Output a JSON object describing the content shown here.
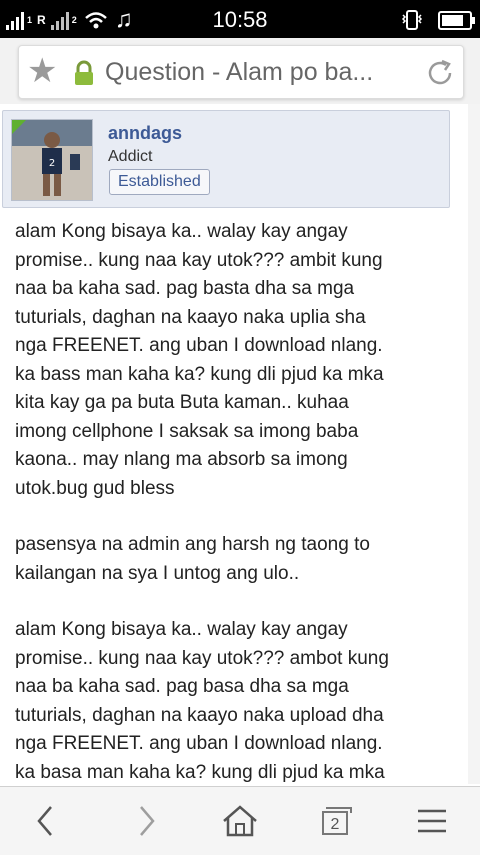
{
  "status_bar": {
    "carrier_label": "R",
    "time": "10:58"
  },
  "browser": {
    "page_title": "Question - Alam po ba...",
    "icons": [
      "star-icon",
      "lock-icon",
      "reload-icon",
      "back-icon",
      "forward-icon",
      "home-icon",
      "tabs-icon",
      "menu-icon"
    ],
    "tab_count": "2"
  },
  "post": {
    "author": {
      "username": "anndags",
      "title": "Addict",
      "rank": "Established"
    },
    "paragraphs": [
      {
        "lines": [
          "alam Kong bisaya ka.. walay kay angay",
          "promise.. kung naa kay utok??? ambit kung",
          "naa ba kaha sad. pag basta dha sa mga",
          "tuturials, daghan na kaayo naka uplia sha",
          "nga FREENET. ang uban I download nlang.",
          "ka bass man kaha ka? kung dli pjud ka mka",
          "kita kay ga pa buta Buta kaman.. kuhaa",
          "imong cellphone I saksak sa imong baba",
          "kaona.. may nlang ma absorb sa imong",
          "utok.bug gud bless"
        ]
      },
      {
        "lines": [
          "pasensya na admin ang harsh ng taong to",
          "kailangan na sya I untog ang ulo.."
        ]
      },
      {
        "lines": [
          "alam Kong bisaya ka.. walay kay angay",
          "promise.. kung naa kay utok??? ambot kung",
          "naa ba kaha sad. pag basa dha sa mga",
          "tuturials, daghan na kaayo naka upload dha",
          "nga FREENET. ang uban I download nlang.",
          "ka basa man kaha ka? kung dli pjud ka mka"
        ]
      }
    ]
  },
  "colors": {
    "status_bar": "#000000",
    "username": "#3d5a96",
    "userbox_bg": "#e8ecf4",
    "text": "#222222"
  }
}
